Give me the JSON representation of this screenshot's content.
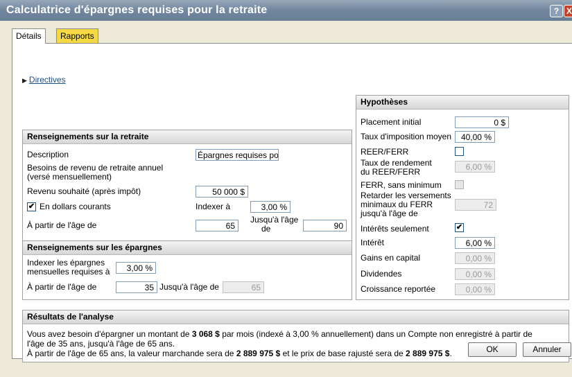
{
  "window": {
    "title": "Calculatrice d'épargnes requises pour la retraite",
    "help_label": "?",
    "close_label": "X"
  },
  "tabs": [
    {
      "label": "Détails",
      "active": true
    },
    {
      "label": "Rapports",
      "active": false
    }
  ],
  "directives": {
    "label": "Directives"
  },
  "retraite": {
    "title": "Renseignements sur la retraite",
    "description_label": "Description",
    "description_value": "Épargnes requises pou",
    "besoins_label_1": "Besoins de revenu de retraite annuel",
    "besoins_label_2": "(versé mensuellement)",
    "revenu_label": "Revenu souhaité (après impôt)",
    "revenu_value": "50 000 $",
    "dollars_courants_label": "En dollars courants",
    "dollars_courants_checked": "✔",
    "indexer_label": "Indexer à",
    "indexer_value": "3,00 %",
    "age_label": "À partir de l'âge de",
    "age_value": "65",
    "jusqua_label_1": "Jusqu'à l'âge",
    "jusqua_label_2": "de",
    "jusqua_value": "90"
  },
  "epargnes": {
    "title": "Renseignements sur les épargnes",
    "indexer_label_1": "Indexer les épargnes",
    "indexer_label_2": "mensuelles requises à",
    "indexer_value": "3,00 %",
    "age_label": "À partir de l'âge de",
    "age_value": "35",
    "jusqua_label": "Jusqu'à l'âge de",
    "jusqua_value": "65"
  },
  "hypotheses": {
    "title": "Hypothèses",
    "placement_label": "Placement initial",
    "placement_value": "0 $",
    "taux_imposition_label": "Taux d'imposition moyen",
    "taux_imposition_value": "40,00 %",
    "reer_label": "REER/FERR",
    "rendement_label_1": "Taux de rendement",
    "rendement_label_2": "du REER/FERR",
    "rendement_value": "6,00 %",
    "ferr_min_label": "FERR, sans minimum",
    "retarder_label_1": "Retarder les versements",
    "retarder_label_2": "minimaux du FERR",
    "retarder_label_3": "jusqu'à l'âge de",
    "retarder_value": "72",
    "interets_seulement_label": "Intérêts seulement",
    "interets_seulement_checked": "✔",
    "interet_label": "Intérêt",
    "interet_value": "6,00 %",
    "gains_label": "Gains en capital",
    "gains_value": "0,00 %",
    "dividendes_label": "Dividendes",
    "dividendes_value": "0,00 %",
    "croissance_label": "Croissance reportée",
    "croissance_value": "0,00 %"
  },
  "resultats": {
    "title": "Résultats de l'analyse",
    "l1_a": "Vous avez besoin d'épargner un montant de",
    "l1_b": "3 068 $",
    "l1_c": "par mois (indexé à 3,00 % annuellement) dans un Compte non enregistré à partir de",
    "l2": "l'âge de 35 ans, jusqu'à l'âge de 65 ans.",
    "l3_a": "À partir de l'âge de 65 ans, la valeur marchande sera de",
    "l3_b": "2 889 975 $",
    "l3_c": "et le prix de base rajusté sera de",
    "l3_d": "2 889 975 $",
    "l3_e": "."
  },
  "buttons": {
    "ok": "OK",
    "annuler": "Annuler"
  }
}
